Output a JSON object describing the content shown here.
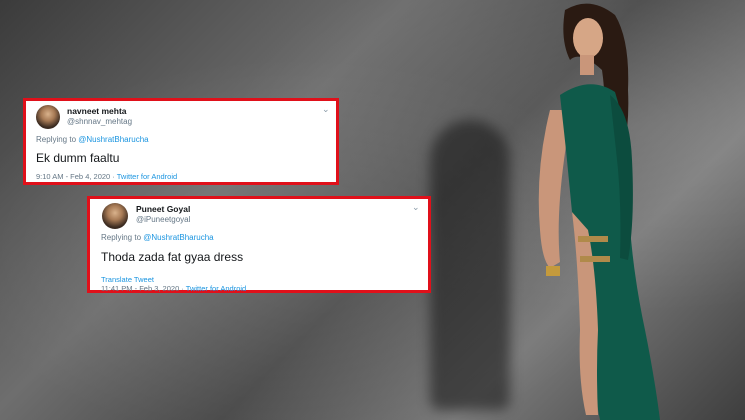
{
  "tweets": [
    {
      "name": "navneet mehta",
      "handle": "@shnnav_mehtag",
      "replying_prefix": "Replying to ",
      "replying_to": "@NushratBharucha",
      "text": "Ek dumm faaltu",
      "timestamp": "9:10 AM - Feb 4, 2020 · ",
      "via": "Twitter for Android",
      "menu_icon": "chevron-down-icon"
    },
    {
      "name": "Puneet Goyal",
      "handle": "@iPuneetgoyal",
      "replying_prefix": "Replying to ",
      "replying_to": "@NushratBharucha",
      "text": "Thoda zada fat gyaa dress",
      "translate": "Translate Tweet",
      "timestamp": "11:41 PM - Feb 3, 2020 · ",
      "via": "Twitter for Android",
      "menu_icon": "chevron-down-icon"
    }
  ],
  "colors": {
    "frame_border": "#e0101a",
    "link": "#1b95e0",
    "dress": "#0f5a4a",
    "background": "#5a5a5a"
  }
}
